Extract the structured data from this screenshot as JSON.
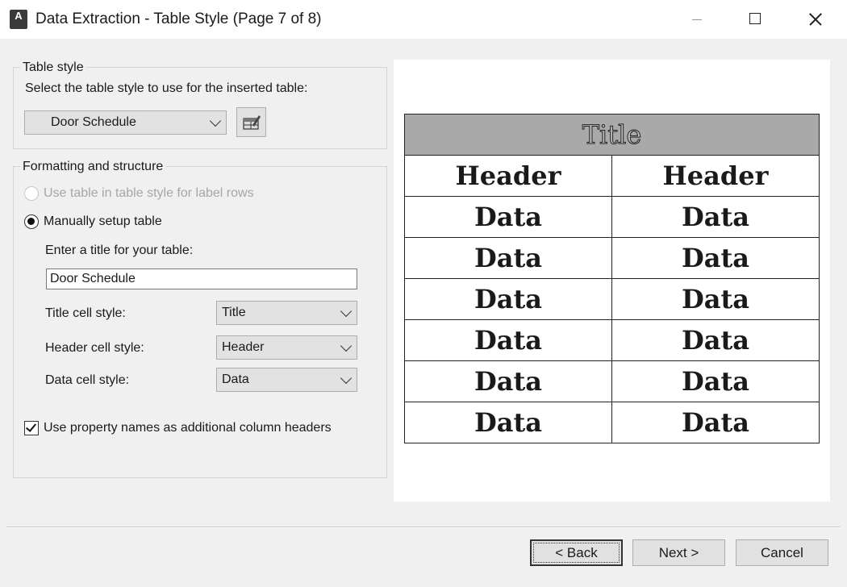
{
  "window": {
    "title": "Data Extraction - Table Style (Page 7 of 8)",
    "app_icon_letter": "A"
  },
  "table_style": {
    "legend": "Table style",
    "instruction": "Select the table style to use for the inserted table:",
    "selected_style": "Door Schedule"
  },
  "formatting": {
    "legend": "Formatting and structure",
    "use_table_option": "Use table in table style for label rows",
    "use_table_enabled": false,
    "manual_option": "Manually setup table",
    "manual_selected": true,
    "title_prompt": "Enter a title for your table:",
    "title_value": "Door Schedule",
    "title_cell_label": "Title cell style:",
    "title_cell_value": "Title",
    "header_cell_label": "Header cell style:",
    "header_cell_value": "Header",
    "data_cell_label": "Data cell style:",
    "data_cell_value": "Data",
    "property_names_label": "Use property names as additional column headers",
    "property_names_checked": true
  },
  "preview": {
    "title": "Title",
    "headers": [
      "Header",
      "Header"
    ],
    "rows": [
      [
        "Data",
        "Data"
      ],
      [
        "Data",
        "Data"
      ],
      [
        "Data",
        "Data"
      ],
      [
        "Data",
        "Data"
      ],
      [
        "Data",
        "Data"
      ],
      [
        "Data",
        "Data"
      ]
    ]
  },
  "buttons": {
    "back": "< Back",
    "next": "Next >",
    "cancel": "Cancel"
  }
}
